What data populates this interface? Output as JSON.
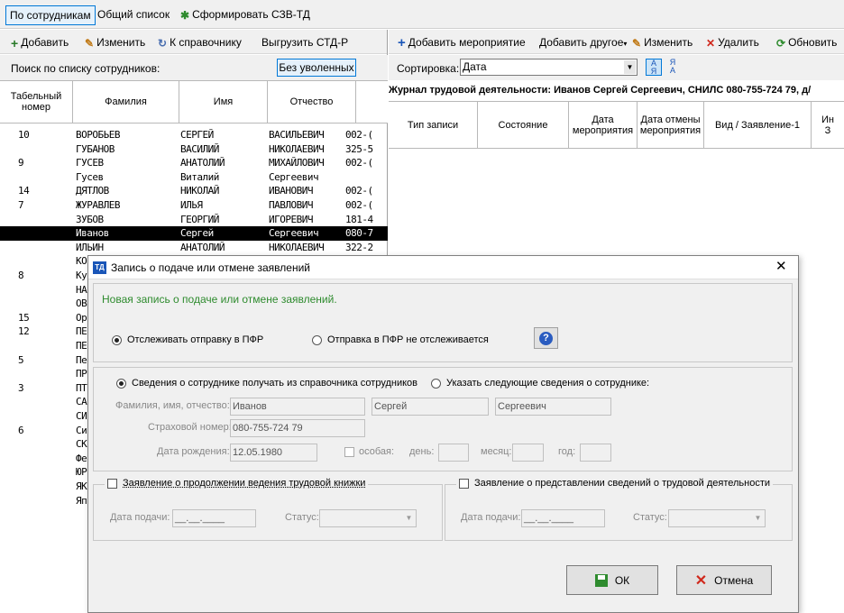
{
  "top_tabs": {
    "by_employee": "По сотрудникам",
    "general_list": "Общий список",
    "generate": "Сформировать СЗВ-ТД"
  },
  "left_toolbar": {
    "add": "Добавить",
    "edit": "Изменить",
    "to_directory": "К справочнику",
    "export": "Выгрузить СТД-Р"
  },
  "search": {
    "label": "Поиск по списку сотрудников:",
    "value": "",
    "without_fired": "Без уволенных"
  },
  "employees_table": {
    "headers": [
      "Табельный номер",
      "Фамилия",
      "Имя",
      "Отчество",
      ""
    ],
    "rows": [
      [
        "10",
        "ВОРОБЬЕВ",
        "СЕРГЕЙ",
        "ВАСИЛЬЕВИЧ",
        "002-("
      ],
      [
        "",
        "ГУБАНОВ",
        "ВАСИЛИЙ",
        "НИКОЛАЕВИЧ",
        "325-5"
      ],
      [
        "9",
        "ГУСЕВ",
        "АНАТОЛИЙ",
        "МИХАЙЛОВИЧ",
        "002-("
      ],
      [
        "",
        "Гусев",
        "Виталий",
        "Сергеевич",
        ""
      ],
      [
        "14",
        "ДЯТЛОВ",
        "НИКОЛАЙ",
        "ИВАНОВИЧ",
        "002-("
      ],
      [
        "7",
        "ЖУРАВЛЕВ",
        "ИЛЬЯ",
        "ПАВЛОВИЧ",
        "002-("
      ],
      [
        "",
        "ЗУБОВ",
        "ГЕОРГИЙ",
        "ИГОРЕВИЧ",
        "181-4"
      ],
      [
        "",
        "Иванов",
        "Сергей",
        "Сергеевич",
        "080-7"
      ],
      [
        "",
        "ИЛЬИН",
        "АНАТОЛИЙ",
        "НИКОЛАЕВИЧ",
        "322-2"
      ],
      [
        "",
        "КО",
        "",
        "",
        ""
      ],
      [
        "8",
        "Ку",
        "",
        "",
        ""
      ],
      [
        "",
        "НА",
        "",
        "",
        ""
      ],
      [
        "",
        "ОВ",
        "",
        "",
        ""
      ],
      [
        "15",
        "Ор",
        "",
        "",
        ""
      ],
      [
        "12",
        "ПЕ",
        "",
        "",
        ""
      ],
      [
        "",
        "ПЕ",
        "",
        "",
        ""
      ],
      [
        "5",
        "Пе",
        "",
        "",
        ""
      ],
      [
        "",
        "ПР",
        "",
        "",
        ""
      ],
      [
        "3",
        "ПТ",
        "",
        "",
        ""
      ],
      [
        "",
        "СА",
        "",
        "",
        ""
      ],
      [
        "",
        "СИ",
        "",
        "",
        ""
      ],
      [
        "6",
        "Си",
        "",
        "",
        ""
      ],
      [
        "",
        "СК",
        "",
        "",
        ""
      ],
      [
        "",
        "Фе",
        "",
        "",
        ""
      ],
      [
        "",
        "ЮР",
        "",
        "",
        ""
      ],
      [
        "",
        "ЯК",
        "",
        "",
        ""
      ],
      [
        "",
        "Яп",
        "",
        "",
        ""
      ]
    ]
  },
  "right_toolbar": {
    "add_event": "Добавить мероприятие",
    "add_other": "Добавить другое",
    "edit": "Изменить",
    "delete": "Удалить",
    "refresh": "Обновить"
  },
  "sorting": {
    "label": "Сортировка:",
    "value": "Дата"
  },
  "journal_title": "Журнал трудовой деятельности: Иванов Сергей Сергеевич, СНИЛС 080-755-724 79, д/",
  "journal_headers": [
    "Тип записи",
    "Состояние",
    "Дата мероприятия",
    "Дата отмены мероприятия",
    "Вид / Заявление-1",
    "Ин\nЗ"
  ],
  "dialog": {
    "icon_text": "ТД",
    "title": "Запись о подаче или отмене заявлений",
    "header": "Новая запись о подаче или отмене заявлений.",
    "track_pfr": "Отслеживать отправку в ПФР",
    "no_track_pfr": "Отправка в ПФР не отслеживается",
    "from_directory": "Сведения о сотруднике получать из справочника сотрудников",
    "specify": "Указать следующие сведения о сотруднике:",
    "fio_label": "Фамилия, имя, отчество:",
    "last_name": "Иванов",
    "first_name": "Сергей",
    "middle_name": "Сергеевич",
    "insurance_label": "Страховой номер:",
    "insurance": "080-755-724 79",
    "birth_label": "Дата рождения:",
    "birth": "12.05.1980",
    "special_label": "особая:",
    "day_label": "день:",
    "month_label": "месяц:",
    "year_label": "год:",
    "left_group": {
      "title": "Заявление о продолжении ведения трудовой книжки",
      "date_label": "Дата подачи:",
      "date_value": "__.__.____",
      "status_label": "Статус:"
    },
    "right_group": {
      "title": "Заявление о представлении сведений о трудовой деятельности",
      "date_label": "Дата подачи:",
      "date_value": "__.__.____",
      "status_label": "Статус:"
    },
    "ok": "ОК",
    "cancel": "Отмена"
  },
  "colors": {
    "accent_blue": "#0078d7",
    "header_green": "#2e8b2e",
    "selected_row": "#000000",
    "cancel_red": "#d0281c"
  }
}
